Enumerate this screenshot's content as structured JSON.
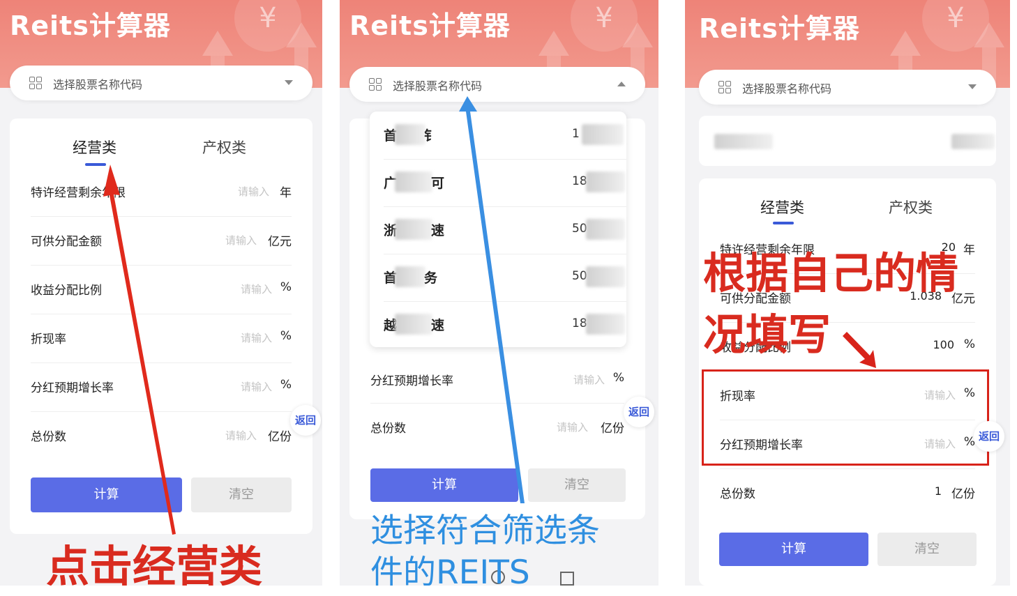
{
  "app_title": "Reits计算器",
  "select_placeholder": "选择股票名称代码",
  "tabs": {
    "operating": "经营类",
    "property": "产权类"
  },
  "input_placeholder": "请输入",
  "fields": {
    "remaining_years": {
      "label": "特许经营剩余年限",
      "unit": "年"
    },
    "distributable_amount": {
      "label": "可供分配金额",
      "unit": "亿元"
    },
    "distribution_ratio": {
      "label": "收益分配比例",
      "unit": "%"
    },
    "discount_rate": {
      "label": "折现率",
      "unit": "%"
    },
    "dividend_growth": {
      "label": "分红预期增长率",
      "unit": "%"
    },
    "total_shares": {
      "label": "总份数",
      "unit": "亿份"
    }
  },
  "buttons": {
    "calc": "计算",
    "clear": "清空",
    "back": "返回"
  },
  "dropdown_list": [
    {
      "first_char": "首",
      "last_char": "钅",
      "code_start": "1"
    },
    {
      "first_char": "广",
      "last_char": "可",
      "code_start": "18"
    },
    {
      "first_char": "浙",
      "last_char": "速",
      "code_start": "50"
    },
    {
      "first_char": "首",
      "last_char": "务",
      "code_start": "50"
    },
    {
      "first_char": "越",
      "last_char": "速",
      "code_start": "18"
    }
  ],
  "panel3_values": {
    "remaining_years": "20",
    "distributable_amount": "1.038",
    "distribution_ratio": "100",
    "total_shares": "1"
  },
  "annotations": {
    "panel1": "点击经营类",
    "panel2_line1": "选择符合筛选条",
    "panel2_line2": "件的REITS",
    "panel3_line1": "根据自己的情",
    "panel3_line2": "况填写"
  },
  "colors": {
    "header": "#ee8378",
    "accent_blue": "#5a6ce6",
    "annotation_red": "#d92b1f",
    "annotation_blue": "#2f8fe0"
  }
}
